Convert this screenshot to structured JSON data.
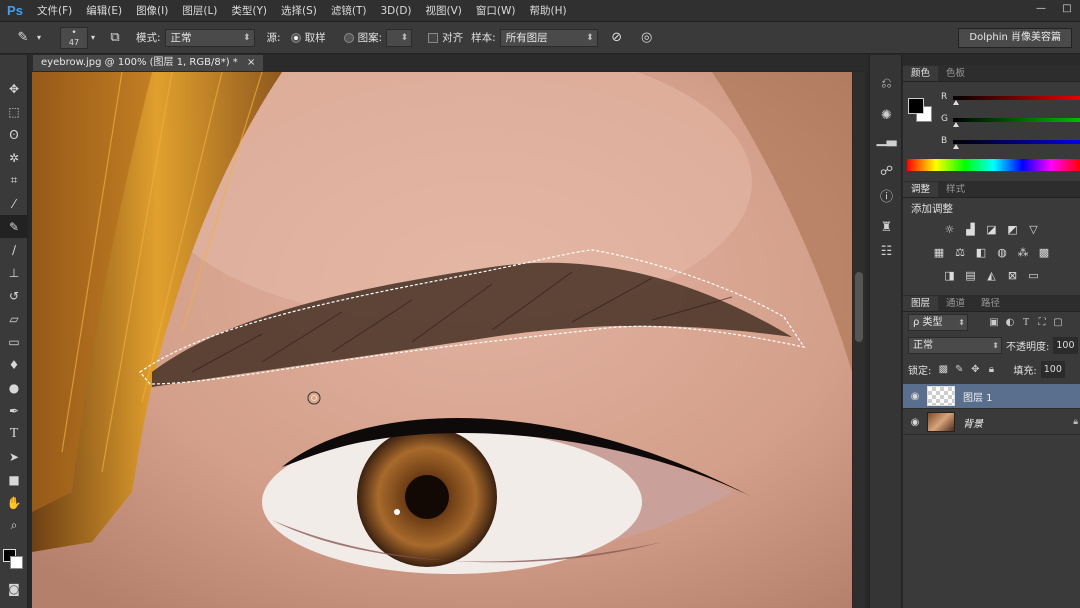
{
  "app": {
    "logo": "Ps"
  },
  "menubar": {
    "items": [
      "文件(F)",
      "编辑(E)",
      "图像(I)",
      "图层(L)",
      "类型(Y)",
      "选择(S)",
      "滤镜(T)",
      "3D(D)",
      "视图(V)",
      "窗口(W)",
      "帮助(H)"
    ],
    "minimize": "—",
    "maximize": "□"
  },
  "options": {
    "brush_size": "47",
    "mode_label": "模式:",
    "mode_value": "正常",
    "source_label": "源:",
    "sampled_label": "取样",
    "pattern_label": "图案:",
    "aligned_label": "对齐",
    "sample_label": "样本:",
    "sample_value": "所有图层",
    "workspace": "Dolphin 肖像美容篇"
  },
  "document": {
    "tab_label": "eyebrow.jpg @ 100% (图层 1, RGB/8*) *",
    "close": "×"
  },
  "color_panel": {
    "tabs": [
      "颜色",
      "色板"
    ],
    "channels": [
      {
        "label": "R",
        "value": "0"
      },
      {
        "label": "G",
        "value": "0"
      },
      {
        "label": "B",
        "value": "0"
      }
    ],
    "foreground": "#000000",
    "background": "#ffffff"
  },
  "adjust_panel": {
    "tabs": [
      "调整",
      "样式"
    ],
    "title": "添加调整"
  },
  "layers_panel": {
    "tabs": [
      "图层",
      "通道",
      "路径"
    ],
    "filter_label": "ρ 类型",
    "blend_mode": "正常",
    "opacity_label": "不透明度:",
    "opacity_value": "100",
    "lock_label": "锁定:",
    "fill_label": "填充:",
    "fill_value": "100",
    "layers": [
      {
        "name": "图层 1",
        "selected": true
      },
      {
        "name": "背景",
        "selected": false
      }
    ]
  }
}
